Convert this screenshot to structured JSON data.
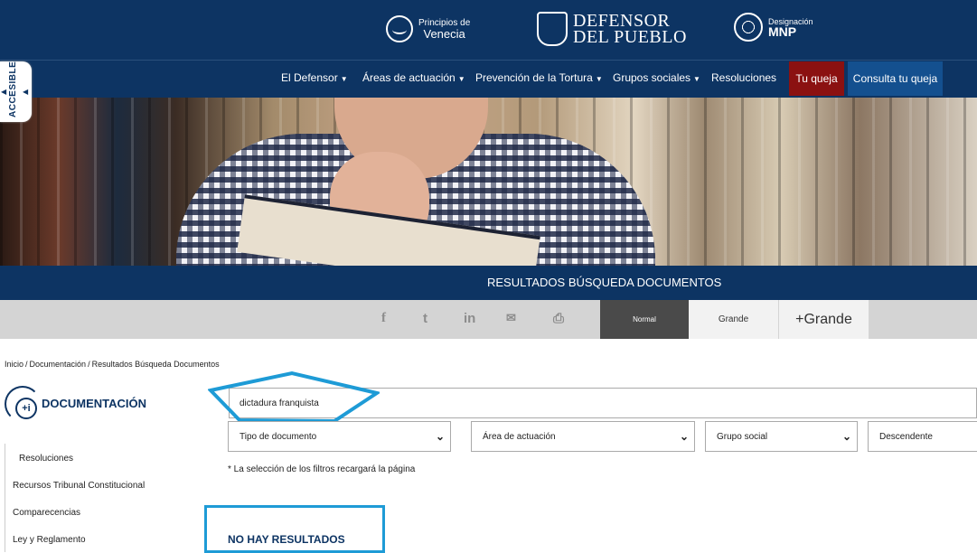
{
  "header": {
    "logo_venecia_small": "Principios de",
    "logo_venecia_big": "Venecia",
    "logo_defensor_1": "DEFENSOR",
    "logo_defensor_2": "DEL PUEBLO",
    "logo_mnp_small": "Designación",
    "logo_mnp_big": "MNP"
  },
  "nav": {
    "items": [
      {
        "label": "El Defensor"
      },
      {
        "label": "Áreas de actuación"
      },
      {
        "label": "Prevención de la Tortura"
      },
      {
        "label": "Grupos sociales"
      },
      {
        "label": "Resoluciones"
      }
    ],
    "tu_queja": "Tu queja",
    "consulta": "Consulta tu queja",
    "accesible": "ACCESIBLE"
  },
  "page_title": "RESULTADOS BÚSQUEDA DOCUMENTOS",
  "share": {
    "facebook": "f",
    "twitter": "t",
    "linkedin": "in",
    "email": "✉",
    "print": "⎙"
  },
  "font_size": {
    "normal": "Normal",
    "grande": "Grande",
    "mas_grande": "+Grande"
  },
  "breadcrumb": {
    "inicio": "Inicio",
    "documentacion": "Documentación",
    "current": "Resultados Búsqueda Documentos"
  },
  "section_title": "DOCUMENTACIÓN",
  "sidebar": {
    "items": [
      {
        "label": "Resoluciones"
      },
      {
        "label": "Recursos Tribunal Constitucional"
      },
      {
        "label": "Comparecencias"
      },
      {
        "label": "Ley y Reglamento"
      }
    ]
  },
  "search": {
    "value": "dictadura franquista"
  },
  "filters": {
    "tipo": "Tipo de documento",
    "area": "Área de actuación",
    "grupo": "Grupo social",
    "orden": "Descendente"
  },
  "filter_note": "* La selección de los filtros recargará la página",
  "result_message": "NO HAY RESULTADOS",
  "colors": {
    "navy": "#0d3463",
    "queja_red": "#8b1111",
    "consulta_blue": "#14508f",
    "annotation_blue": "#1e9bd6"
  }
}
